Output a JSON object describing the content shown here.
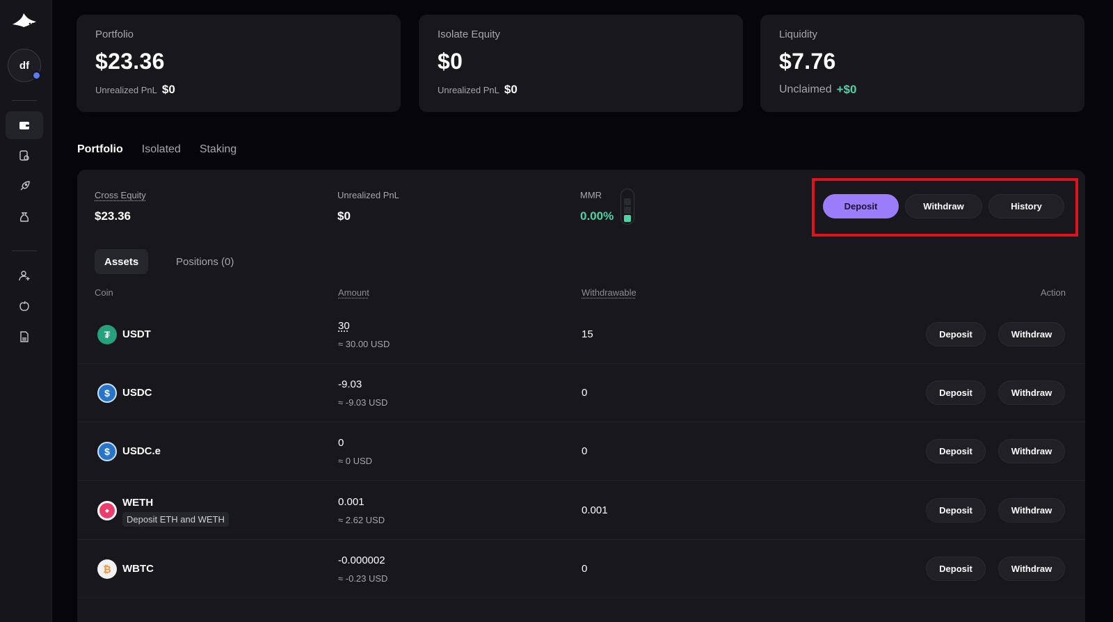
{
  "avatar": {
    "initials": "df"
  },
  "cards": [
    {
      "label": "Portfolio",
      "value": "$23.36",
      "sub_label": "Unrealized PnL",
      "sub_value": "$0"
    },
    {
      "label": "Isolate Equity",
      "value": "$0",
      "sub_label": "Unrealized PnL",
      "sub_value": "$0"
    },
    {
      "label": "Liquidity",
      "value": "$7.76",
      "sub_label": "Unclaimed",
      "sub_value": "+$0"
    }
  ],
  "tabs": [
    "Portfolio",
    "Isolated",
    "Staking"
  ],
  "summary": {
    "cross_equity_label": "Cross Equity",
    "cross_equity": "$23.36",
    "pnl_label": "Unrealized PnL",
    "pnl": "$0",
    "mmr_label": "MMR",
    "mmr": "0.00%"
  },
  "actions": {
    "deposit": "Deposit",
    "withdraw": "Withdraw",
    "history": "History"
  },
  "subtabs": [
    "Assets",
    "Positions (0)"
  ],
  "table": {
    "headers": {
      "coin": "Coin",
      "amount": "Amount",
      "withdrawable": "Withdrawable",
      "action": "Action"
    },
    "rows": [
      {
        "coin": "USDT",
        "tag": "",
        "amount": "30",
        "usd": "≈ 30.00 USD",
        "withdrawable": "15"
      },
      {
        "coin": "USDC",
        "tag": "",
        "amount": "-9.03",
        "usd": "≈ -9.03 USD",
        "withdrawable": "0"
      },
      {
        "coin": "USDC.e",
        "tag": "",
        "amount": "0",
        "usd": "≈ 0 USD",
        "withdrawable": "0"
      },
      {
        "coin": "WETH",
        "tag": "Deposit ETH and WETH",
        "amount": "0.001",
        "usd": "≈ 2.62 USD",
        "withdrawable": "0.001"
      },
      {
        "coin": "WBTC",
        "tag": "",
        "amount": "-0.000002",
        "usd": "≈ -0.23 USD",
        "withdrawable": "0"
      }
    ],
    "row_deposit": "Deposit",
    "row_withdraw": "Withdraw"
  },
  "colors": {
    "accent": "#9b7cfa",
    "positive": "#4fd1a5",
    "highlight": "#e0121a"
  }
}
